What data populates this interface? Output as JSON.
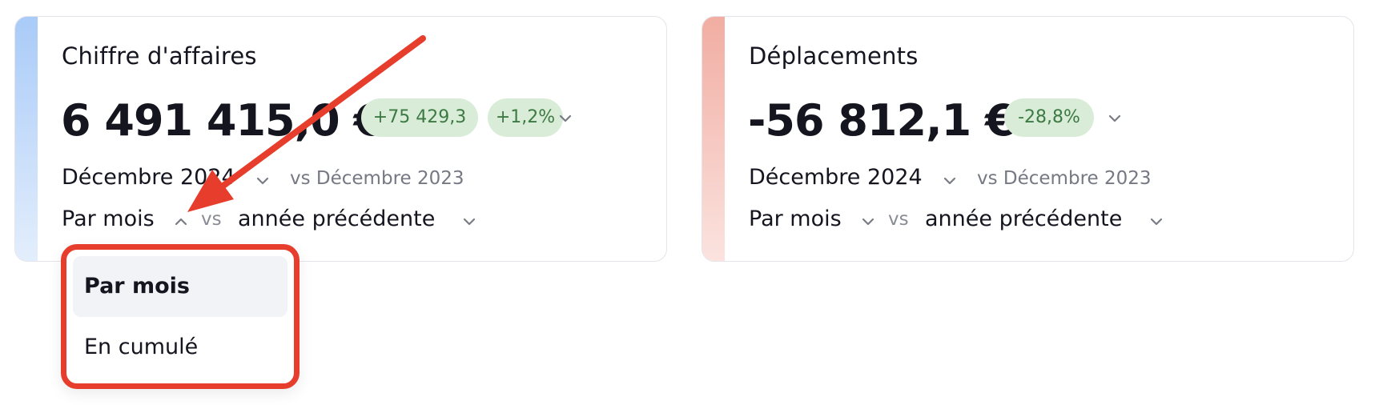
{
  "cards": [
    {
      "title": "Chiffre d'affaires",
      "value": "6 491 415,0 €",
      "badges": [
        "+75 429,3",
        "+1,2%"
      ],
      "period": "Décembre 2024",
      "comparison": "vs Décembre 2023",
      "mode": "Par mois",
      "vs_label": "vs",
      "compare_mode": "année précédente",
      "accent_color": "#a9cbf8"
    },
    {
      "title": "Déplacements",
      "value": "-56 812,1 €",
      "badges": [
        "-28,8%"
      ],
      "period": "Décembre 2024",
      "comparison": "vs Décembre 2023",
      "mode": "Par mois",
      "vs_label": "vs",
      "compare_mode": "année précédente",
      "accent_color": "#f1ada2"
    }
  ],
  "dropdown": {
    "options": [
      "Par mois",
      "En cumulé"
    ],
    "selected": "Par mois"
  },
  "colors": {
    "badge_bg": "#d8ecd7",
    "badge_text": "#3d7a43",
    "highlight_red": "#e63d2c"
  },
  "icons": {
    "chevron": "chevron-down-icon",
    "chevron_open": "chevron-up-icon",
    "annotation": "red-arrow-annotation"
  }
}
